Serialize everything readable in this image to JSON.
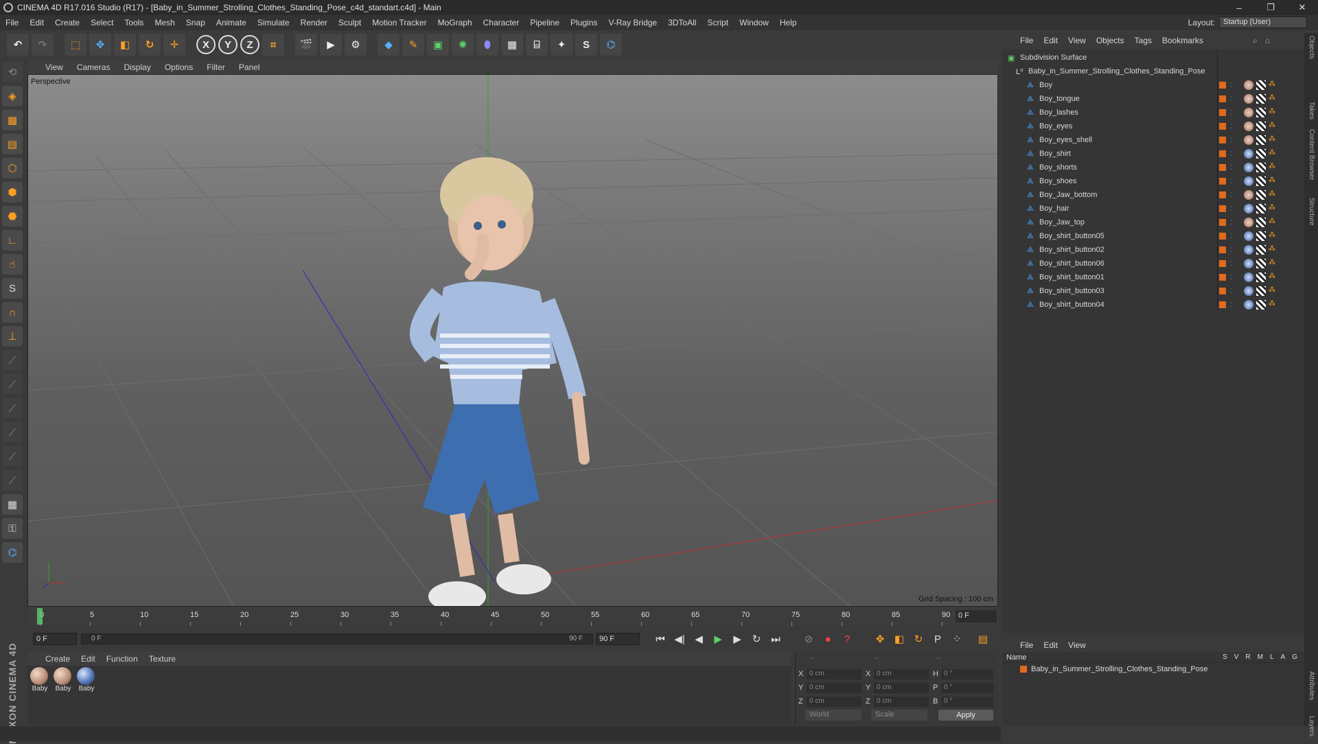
{
  "window": {
    "title": "CINEMA 4D R17.016 Studio (R17) - [Baby_in_Summer_Strolling_Clothes_Standing_Pose_c4d_standart.c4d] - Main",
    "controls": [
      "–",
      "❐",
      "✕"
    ]
  },
  "menu": [
    "File",
    "Edit",
    "Create",
    "Select",
    "Tools",
    "Mesh",
    "Snap",
    "Animate",
    "Simulate",
    "Render",
    "Sculpt",
    "Motion Tracker",
    "MoGraph",
    "Character",
    "Pipeline",
    "Plugins",
    "V-Ray Bridge",
    "3DToAll",
    "Script",
    "Window",
    "Help"
  ],
  "layout": {
    "label": "Layout:",
    "value": "Startup (User)"
  },
  "toolbar_icons": [
    "undo-icon",
    "redo-icon",
    "select-icon",
    "move-icon",
    "scale-icon",
    "rotate-icon",
    "transform-icon",
    "x-axis-icon",
    "y-axis-icon",
    "z-axis-icon",
    "coordinate-system-icon",
    "render-view-icon",
    "render-picture-viewer-icon",
    "render-settings-icon",
    "cube-icon",
    "pen-icon",
    "subdivision-icon",
    "array-icon",
    "deformer-icon",
    "floor-icon",
    "camera-icon",
    "light-icon",
    "sketch-icon",
    "python-icon"
  ],
  "viewport": {
    "menu": [
      "View",
      "Cameras",
      "Display",
      "Options",
      "Filter",
      "Panel"
    ],
    "label": "Perspective",
    "grid_spacing": "Grid Spacing : 100 cm"
  },
  "timeline": {
    "ticks": [
      "0",
      "5",
      "10",
      "15",
      "20",
      "25",
      "30",
      "35",
      "40",
      "45",
      "50",
      "55",
      "60",
      "65",
      "70",
      "75",
      "80",
      "85",
      "90"
    ],
    "current_frame": "0 F",
    "start_field": "0 F",
    "range_start": "0 F",
    "range_end": "90 F",
    "end_field": "90 F"
  },
  "material_manager": {
    "menu": [
      "Create",
      "Edit",
      "Function",
      "Texture"
    ],
    "materials": [
      {
        "label": "Baby",
        "type": "skin"
      },
      {
        "label": "Baby",
        "type": "skin"
      },
      {
        "label": "Baby",
        "type": "eye"
      }
    ]
  },
  "coordinates": {
    "header": [
      "--",
      "--",
      "--"
    ],
    "rows": [
      {
        "a": "X",
        "v1": "0 cm",
        "b": "X",
        "v2": "0 cm",
        "c": "H",
        "v3": "0 °"
      },
      {
        "a": "Y",
        "v1": "0 cm",
        "b": "Y",
        "v2": "0 cm",
        "c": "P",
        "v3": "0 °"
      },
      {
        "a": "Z",
        "v1": "0 cm",
        "b": "Z",
        "v2": "0 cm",
        "c": "B",
        "v3": "0 °"
      }
    ],
    "world": "World",
    "scale": "Scale",
    "apply": "Apply"
  },
  "object_manager": {
    "menu": [
      "File",
      "Edit",
      "View",
      "Objects",
      "Tags",
      "Bookmarks"
    ],
    "root": "Subdivision Surface",
    "group": "Baby_in_Summer_Strolling_Clothes_Standing_Pose",
    "objects": [
      {
        "name": "Boy",
        "tag": "skin"
      },
      {
        "name": "Boy_tongue",
        "tag": "skin"
      },
      {
        "name": "Boy_lashes",
        "tag": "skin"
      },
      {
        "name": "Boy_eyes",
        "tag": "skin"
      },
      {
        "name": "Boy_eyes_shell",
        "tag": "skin"
      },
      {
        "name": "Boy_shirt",
        "tag": "eye"
      },
      {
        "name": "Boy_shorts",
        "tag": "eye"
      },
      {
        "name": "Boy_shoes",
        "tag": "eye"
      },
      {
        "name": "Boy_Jaw_bottom",
        "tag": "skin"
      },
      {
        "name": "Boy_hair",
        "tag": "eye"
      },
      {
        "name": "Boy_Jaw_top",
        "tag": "skin"
      },
      {
        "name": "Boy_shirt_button05",
        "tag": "eye"
      },
      {
        "name": "Boy_shirt_button02",
        "tag": "eye"
      },
      {
        "name": "Boy_shirt_button06",
        "tag": "eye"
      },
      {
        "name": "Boy_shirt_button01",
        "tag": "eye"
      },
      {
        "name": "Boy_shirt_button03",
        "tag": "eye"
      },
      {
        "name": "Boy_shirt_button04",
        "tag": "eye"
      }
    ]
  },
  "layers_manager": {
    "menu": [
      "File",
      "Edit",
      "View"
    ],
    "name_col": "Name",
    "cols": [
      "S",
      "V",
      "R",
      "M",
      "L",
      "A",
      "G"
    ],
    "row": "Baby_in_Summer_Strolling_Clothes_Standing_Pose"
  },
  "side_tabs": [
    "Objects",
    "Takes",
    "Content Browser",
    "Structure",
    "Attributes",
    "Layers"
  ],
  "colors": {
    "accent": "#ffa020",
    "object_icon": "#4aa8ff",
    "layer": "#e06a20"
  }
}
